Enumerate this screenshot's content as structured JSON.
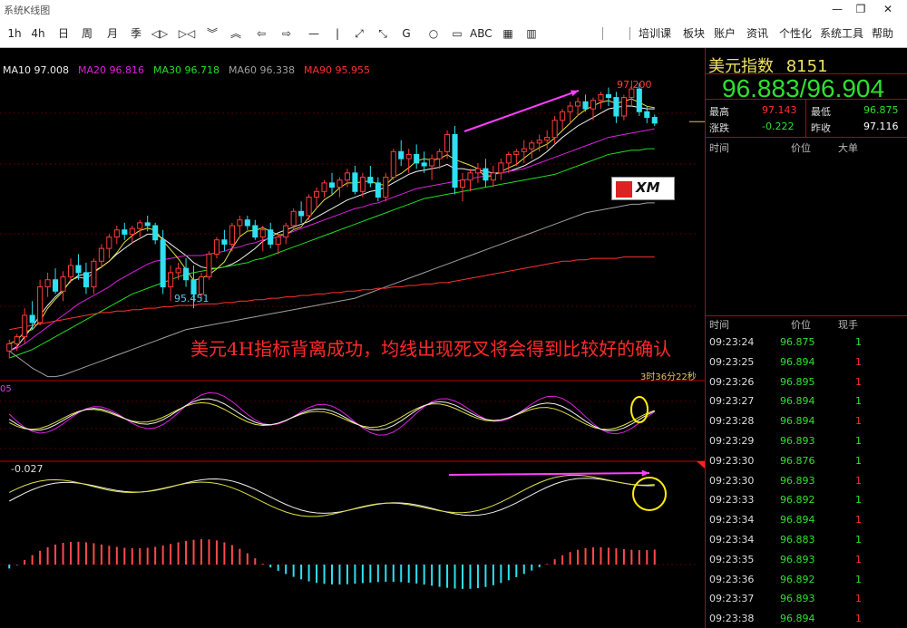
{
  "window": {
    "title": "系统K线图",
    "controls": [
      "—",
      "❐",
      "✕"
    ]
  },
  "toolbar": {
    "tools": [
      "1h",
      "4h",
      "日",
      "周",
      "月",
      "季",
      "◁▷",
      "▷◁",
      "︾",
      "︽",
      "⇦",
      "⇨",
      "—",
      "|",
      "⤢",
      "⤡",
      "G",
      "○",
      "▭",
      "ABC",
      "▦",
      "▥"
    ],
    "menus": [
      "培训课",
      "板块",
      "账户",
      "资讯",
      "个性化",
      "系统工具",
      "帮助"
    ]
  },
  "ma_legend": [
    {
      "label": "MA10 97.008",
      "color": "#f0f0f0"
    },
    {
      "label": "MA20 96.816",
      "color": "#e020e0"
    },
    {
      "label": "MA30 96.718",
      "color": "#20e020"
    },
    {
      "label": "MA60 96.338",
      "color": "#a0a0a0"
    },
    {
      "label": "MA90 95.955",
      "color": "#ff3030"
    }
  ],
  "chart_labels": {
    "high": "97.200",
    "low": "95.451",
    "annotation": "美元4H指标背离成功，均线出现死叉将会得到比较好的确认",
    "countdown": "3时36分22秒",
    "kdj": "05",
    "macd": "-0.027",
    "logo": "XM"
  },
  "chart_data": {
    "type": "candlestick",
    "title": "美元指数",
    "ylim": [
      95.2,
      97.3
    ],
    "candles": [
      [
        95.3,
        95.38,
        95.25,
        95.35
      ],
      [
        95.35,
        95.42,
        95.3,
        95.4
      ],
      [
        95.4,
        95.6,
        95.35,
        95.55
      ],
      [
        95.55,
        95.65,
        95.45,
        95.5
      ],
      [
        95.5,
        95.8,
        95.48,
        95.75
      ],
      [
        95.75,
        95.85,
        95.68,
        95.8
      ],
      [
        95.8,
        95.88,
        95.7,
        95.72
      ],
      [
        95.72,
        95.86,
        95.65,
        95.82
      ],
      [
        95.82,
        95.95,
        95.78,
        95.9
      ],
      [
        95.9,
        95.98,
        95.8,
        95.85
      ],
      [
        95.85,
        95.92,
        95.7,
        95.75
      ],
      [
        95.75,
        95.95,
        95.7,
        95.93
      ],
      [
        95.93,
        96.05,
        95.88,
        96.02
      ],
      [
        96.02,
        96.12,
        95.95,
        96.1
      ],
      [
        96.1,
        96.18,
        96.05,
        96.15
      ],
      [
        96.15,
        96.2,
        96.08,
        96.12
      ],
      [
        96.12,
        96.18,
        96.05,
        96.16
      ],
      [
        96.16,
        96.22,
        96.1,
        96.2
      ],
      [
        96.2,
        96.25,
        96.14,
        96.18
      ],
      [
        96.18,
        96.2,
        96.05,
        96.08
      ],
      [
        96.08,
        96.15,
        95.7,
        95.75
      ],
      [
        95.75,
        95.9,
        95.65,
        95.85
      ],
      [
        95.85,
        95.92,
        95.8,
        95.88
      ],
      [
        95.88,
        95.95,
        95.75,
        95.8
      ],
      [
        95.8,
        95.9,
        95.6,
        95.7
      ],
      [
        95.7,
        95.85,
        95.65,
        95.82
      ],
      [
        95.82,
        96.0,
        95.8,
        95.98
      ],
      [
        95.98,
        96.1,
        95.95,
        96.08
      ],
      [
        96.08,
        96.15,
        96.0,
        96.05
      ],
      [
        96.05,
        96.2,
        96.0,
        96.18
      ],
      [
        96.18,
        96.25,
        96.1,
        96.22
      ],
      [
        96.22,
        96.25,
        96.15,
        96.18
      ],
      [
        96.18,
        96.22,
        96.08,
        96.1
      ],
      [
        96.1,
        96.18,
        96.0,
        96.15
      ],
      [
        96.15,
        96.2,
        96.02,
        96.05
      ],
      [
        96.05,
        96.12,
        95.98,
        96.1
      ],
      [
        96.1,
        96.2,
        96.05,
        96.18
      ],
      [
        96.18,
        96.3,
        96.15,
        96.28
      ],
      [
        96.28,
        96.35,
        96.2,
        96.25
      ],
      [
        96.25,
        96.4,
        96.22,
        96.38
      ],
      [
        96.38,
        96.45,
        96.3,
        96.42
      ],
      [
        96.42,
        96.5,
        96.38,
        96.48
      ],
      [
        96.48,
        96.55,
        96.4,
        96.45
      ],
      [
        96.45,
        96.52,
        96.38,
        96.5
      ],
      [
        96.5,
        96.58,
        96.45,
        96.55
      ],
      [
        96.55,
        96.6,
        96.4,
        96.42
      ],
      [
        96.42,
        96.55,
        96.38,
        96.52
      ],
      [
        96.52,
        96.6,
        96.45,
        96.48
      ],
      [
        96.48,
        96.52,
        96.35,
        96.38
      ],
      [
        96.38,
        96.55,
        96.35,
        96.52
      ],
      [
        96.52,
        96.72,
        96.5,
        96.7
      ],
      [
        96.7,
        96.78,
        96.6,
        96.65
      ],
      [
        96.65,
        96.72,
        96.55,
        96.68
      ],
      [
        96.68,
        96.75,
        96.58,
        96.62
      ],
      [
        96.62,
        96.7,
        96.55,
        96.6
      ],
      [
        96.6,
        96.68,
        96.5,
        96.65
      ],
      [
        96.65,
        96.72,
        96.58,
        96.7
      ],
      [
        96.7,
        96.85,
        96.65,
        96.82
      ],
      [
        96.82,
        96.88,
        96.4,
        96.45
      ],
      [
        96.45,
        96.55,
        96.35,
        96.5
      ],
      [
        96.5,
        96.58,
        96.42,
        96.55
      ],
      [
        96.55,
        96.62,
        96.48,
        96.58
      ],
      [
        96.58,
        96.65,
        96.45,
        96.5
      ],
      [
        96.5,
        96.6,
        96.45,
        96.55
      ],
      [
        96.55,
        96.65,
        96.5,
        96.62
      ],
      [
        96.62,
        96.7,
        96.55,
        96.68
      ],
      [
        96.68,
        96.72,
        96.6,
        96.7
      ],
      [
        96.7,
        96.78,
        96.62,
        96.72
      ],
      [
        96.72,
        96.78,
        96.65,
        96.76
      ],
      [
        96.76,
        96.82,
        96.7,
        96.78
      ],
      [
        96.78,
        96.85,
        96.72,
        96.8
      ],
      [
        96.8,
        96.95,
        96.75,
        96.92
      ],
      [
        96.92,
        97.0,
        96.85,
        96.98
      ],
      [
        96.98,
        97.05,
        96.9,
        97.02
      ],
      [
        97.02,
        97.08,
        96.95,
        97.05
      ],
      [
        97.05,
        97.1,
        96.98,
        97.0
      ],
      [
        97.0,
        97.08,
        96.92,
        97.06
      ],
      [
        97.06,
        97.12,
        97.0,
        97.1
      ],
      [
        97.1,
        97.15,
        97.02,
        97.08
      ],
      [
        97.08,
        97.12,
        96.9,
        96.95
      ],
      [
        96.95,
        97.1,
        96.92,
        97.08
      ],
      [
        97.08,
        97.2,
        97.02,
        97.14
      ],
      [
        97.14,
        97.18,
        96.95,
        96.98
      ],
      [
        96.98,
        97.02,
        96.9,
        96.94
      ],
      [
        96.94,
        96.96,
        96.88,
        96.9
      ]
    ],
    "ma": {
      "MA10": [
        95.3,
        95.33,
        95.4,
        95.47,
        95.55,
        95.62,
        95.68,
        95.73,
        95.79,
        95.83,
        95.84,
        95.86,
        95.89,
        95.93,
        95.98,
        96.02,
        96.06,
        96.09,
        96.12,
        96.12,
        96.09,
        96.05,
        96.01,
        95.97,
        95.92,
        95.89,
        95.88,
        95.88,
        95.89,
        95.91,
        95.94,
        95.98,
        96.02,
        96.07,
        96.1,
        96.13,
        96.15,
        96.17,
        96.19,
        96.21,
        96.24,
        96.27,
        96.3,
        96.33,
        96.36,
        96.38,
        96.4,
        96.42,
        96.43,
        96.45,
        96.48,
        96.51,
        96.54,
        96.56,
        96.57,
        96.58,
        96.59,
        96.61,
        96.58,
        96.58,
        96.57,
        96.57,
        96.56,
        96.55,
        96.55,
        96.56,
        96.58,
        96.6,
        96.63,
        96.66,
        96.7,
        96.75,
        96.8,
        96.84,
        96.88,
        96.91,
        96.94,
        96.97,
        97.0,
        97.01,
        97.02,
        97.02,
        97.01,
        97.0,
        97.0
      ],
      "MA20": [
        95.3,
        95.32,
        95.35,
        95.39,
        95.43,
        95.47,
        95.51,
        95.55,
        95.59,
        95.63,
        95.66,
        95.69,
        95.72,
        95.75,
        95.79,
        95.82,
        95.85,
        95.88,
        95.91,
        95.93,
        95.94,
        95.95,
        95.96,
        95.97,
        95.97,
        95.97,
        95.98,
        95.99,
        96.0,
        96.02,
        96.03,
        96.05,
        96.06,
        96.08,
        96.09,
        96.1,
        96.12,
        96.14,
        96.16,
        96.18,
        96.2,
        96.22,
        96.24,
        96.26,
        96.28,
        96.3,
        96.31,
        96.33,
        96.34,
        96.36,
        96.38,
        96.4,
        96.42,
        96.44,
        96.45,
        96.46,
        96.47,
        96.48,
        96.49,
        96.5,
        96.51,
        96.52,
        96.53,
        96.54,
        96.55,
        96.56,
        96.57,
        96.58,
        96.6,
        96.62,
        96.64,
        96.66,
        96.68,
        96.7,
        96.72,
        96.74,
        96.76,
        96.78,
        96.8,
        96.81,
        96.82,
        96.83,
        96.84,
        96.85,
        96.86
      ],
      "MA30": [
        95.25,
        95.27,
        95.29,
        95.31,
        95.34,
        95.37,
        95.4,
        95.43,
        95.46,
        95.49,
        95.52,
        95.55,
        95.58,
        95.61,
        95.64,
        95.67,
        95.7,
        95.72,
        95.74,
        95.76,
        95.78,
        95.8,
        95.82,
        95.84,
        95.85,
        95.86,
        95.87,
        95.88,
        95.89,
        95.9,
        95.91,
        95.92,
        95.94,
        95.95,
        95.97,
        95.99,
        96.01,
        96.03,
        96.05,
        96.07,
        96.09,
        96.11,
        96.13,
        96.15,
        96.17,
        96.19,
        96.21,
        96.23,
        96.25,
        96.27,
        96.29,
        96.31,
        96.33,
        96.35,
        96.37,
        96.38,
        96.39,
        96.4,
        96.41,
        96.42,
        96.43,
        96.44,
        96.45,
        96.46,
        96.47,
        96.48,
        96.49,
        96.5,
        96.51,
        96.52,
        96.53,
        96.54,
        96.56,
        96.58,
        96.6,
        96.62,
        96.64,
        96.66,
        96.68,
        96.69,
        96.7,
        96.71,
        96.71,
        96.72,
        96.72
      ],
      "MA60": [
        95.3,
        95.26,
        95.22,
        95.18,
        95.15,
        95.12,
        95.12,
        95.13,
        95.15,
        95.17,
        95.19,
        95.21,
        95.23,
        95.25,
        95.27,
        95.29,
        95.31,
        95.33,
        95.35,
        95.37,
        95.39,
        95.41,
        95.43,
        95.45,
        95.46,
        95.47,
        95.48,
        95.49,
        95.5,
        95.51,
        95.52,
        95.53,
        95.54,
        95.55,
        95.56,
        95.57,
        95.58,
        95.59,
        95.6,
        95.61,
        95.62,
        95.63,
        95.64,
        95.65,
        95.66,
        95.67,
        95.69,
        95.71,
        95.73,
        95.75,
        95.77,
        95.79,
        95.81,
        95.83,
        95.85,
        95.87,
        95.89,
        95.91,
        95.93,
        95.95,
        95.97,
        95.99,
        96.01,
        96.03,
        96.05,
        96.07,
        96.09,
        96.11,
        96.13,
        96.15,
        96.17,
        96.19,
        96.21,
        96.23,
        96.25,
        96.27,
        96.28,
        96.29,
        96.3,
        96.31,
        96.32,
        96.33,
        96.33,
        96.34,
        96.34
      ],
      "MA90": [
        95.45,
        95.46,
        95.47,
        95.48,
        95.49,
        95.5,
        95.51,
        95.52,
        95.53,
        95.54,
        95.55,
        95.56,
        95.57,
        95.57,
        95.58,
        95.58,
        95.59,
        95.59,
        95.6,
        95.6,
        95.61,
        95.61,
        95.62,
        95.62,
        95.62,
        95.63,
        95.63,
        95.63,
        95.64,
        95.64,
        95.65,
        95.65,
        95.66,
        95.66,
        95.67,
        95.67,
        95.68,
        95.68,
        95.69,
        95.69,
        95.7,
        95.7,
        95.71,
        95.71,
        95.72,
        95.72,
        95.73,
        95.73,
        95.74,
        95.74,
        95.75,
        95.75,
        95.76,
        95.76,
        95.77,
        95.77,
        95.78,
        95.78,
        95.79,
        95.8,
        95.81,
        95.82,
        95.83,
        95.84,
        95.85,
        95.86,
        95.87,
        95.88,
        95.89,
        95.9,
        95.91,
        95.92,
        95.93,
        95.93,
        95.94,
        95.94,
        95.95,
        95.95,
        95.95,
        95.95,
        95.96,
        95.96,
        95.96,
        95.96,
        95.96
      ]
    }
  },
  "panel": {
    "title": "美元指数",
    "code": "8151",
    "bid_ask": "96.883/96.904",
    "stats": [
      {
        "label": "最高",
        "value": "97.143",
        "color": "#ff3030"
      },
      {
        "label": "最低",
        "value": "96.875",
        "color": "#30e030"
      },
      {
        "label": "涨跌",
        "value": "-0.222",
        "color": "#30e030"
      },
      {
        "label": "昨收",
        "value": "97.116",
        "color": "#ffffff"
      }
    ],
    "upper_headers": [
      "时间",
      "价位",
      "大单"
    ],
    "lower_headers": [
      "时间",
      "价位",
      "现手"
    ],
    "ticks": [
      {
        "time": "09:23:24",
        "price": "96.875",
        "qty": "1",
        "qcolor": "#30e030"
      },
      {
        "time": "09:23:25",
        "price": "96.894",
        "qty": "1",
        "qcolor": "#ff3030"
      },
      {
        "time": "09:23:26",
        "price": "96.895",
        "qty": "1",
        "qcolor": "#ff3030"
      },
      {
        "time": "09:23:27",
        "price": "96.894",
        "qty": "1",
        "qcolor": "#30e030"
      },
      {
        "time": "09:23:28",
        "price": "96.894",
        "qty": "1",
        "qcolor": "#ff3030"
      },
      {
        "time": "09:23:29",
        "price": "96.893",
        "qty": "1",
        "qcolor": "#30e030"
      },
      {
        "time": "09:23:30",
        "price": "96.876",
        "qty": "1",
        "qcolor": "#30e030"
      },
      {
        "time": "09:23:30",
        "price": "96.893",
        "qty": "1",
        "qcolor": "#ff3030"
      },
      {
        "time": "09:23:33",
        "price": "96.892",
        "qty": "1",
        "qcolor": "#30e030"
      },
      {
        "time": "09:23:34",
        "price": "96.894",
        "qty": "1",
        "qcolor": "#ff3030"
      },
      {
        "time": "09:23:34",
        "price": "96.883",
        "qty": "1",
        "qcolor": "#30e030"
      },
      {
        "time": "09:23:35",
        "price": "96.893",
        "qty": "1",
        "qcolor": "#ff3030"
      },
      {
        "time": "09:23:36",
        "price": "96.892",
        "qty": "1",
        "qcolor": "#30e030"
      },
      {
        "time": "09:23:37",
        "price": "96.893",
        "qty": "1",
        "qcolor": "#ff3030"
      },
      {
        "time": "09:23:38",
        "price": "96.894",
        "qty": "1",
        "qcolor": "#ff3030"
      }
    ]
  }
}
